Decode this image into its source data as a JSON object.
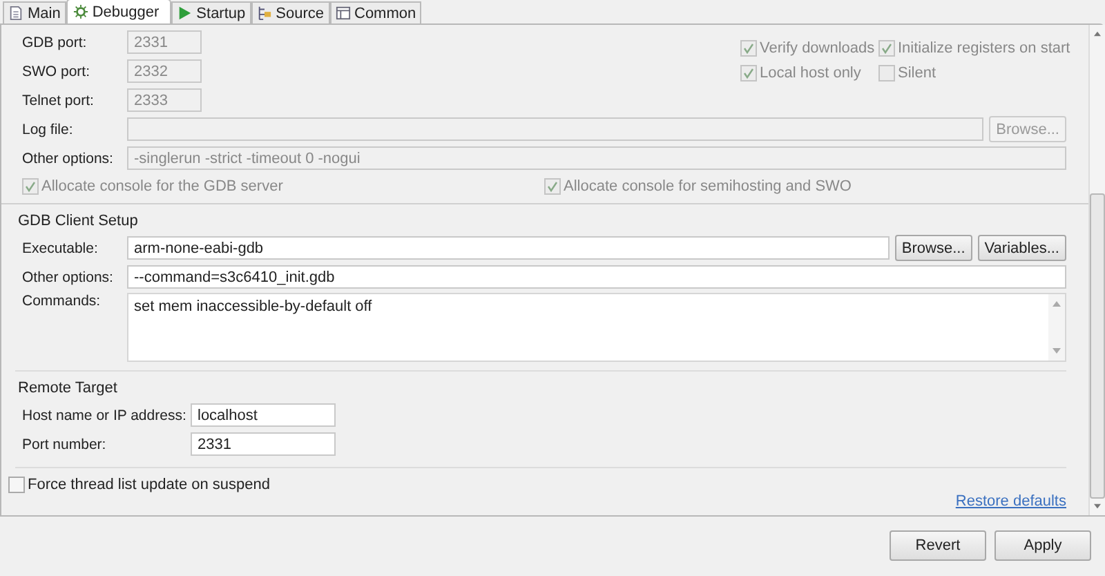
{
  "tabs": [
    {
      "label": "Main",
      "selected": false
    },
    {
      "label": "Debugger",
      "selected": true
    },
    {
      "label": "Startup",
      "selected": false
    },
    {
      "label": "Source",
      "selected": false
    },
    {
      "label": "Common",
      "selected": false
    }
  ],
  "gdb_server": {
    "ports": [
      {
        "label": "GDB port:",
        "value": "2331",
        "disabled": true
      },
      {
        "label": "SWO port:",
        "value": "2332",
        "disabled": true
      },
      {
        "label": "Telnet port:",
        "value": "2333",
        "disabled": true
      }
    ],
    "right_options": [
      [
        {
          "label": "Verify downloads",
          "checked": true,
          "disabled": true
        },
        {
          "label": "Initialize registers on start",
          "checked": true,
          "disabled": true
        }
      ],
      [
        {
          "label": "Local host only",
          "checked": true,
          "disabled": true
        },
        {
          "label": "Silent",
          "checked": false,
          "disabled": true
        }
      ]
    ],
    "log_file": {
      "label": "Log file:",
      "disabled": true,
      "button": "Browse..."
    },
    "other_options": {
      "label": "Other options:",
      "value": "-singlerun -strict -timeout 0 -nogui",
      "disabled": true
    },
    "console_options": [
      {
        "label": "Allocate console for the GDB server",
        "checked": true,
        "disabled": true
      },
      {
        "label": "Allocate console for semihosting and SWO",
        "checked": true,
        "disabled": true
      }
    ]
  },
  "gdb_client": {
    "title": "GDB Client Setup",
    "executable": {
      "label": "Executable:",
      "value": "arm-none-eabi-gdb",
      "buttons": [
        "Browse...",
        "Variables..."
      ]
    },
    "other_options": {
      "label": "Other options:",
      "value": "--command=s3c6410_init.gdb"
    },
    "commands": {
      "label": "Commands:",
      "value": "set mem inaccessible-by-default off"
    }
  },
  "remote_target": {
    "title": "Remote Target",
    "host": {
      "label": "Host name or IP address:",
      "value": "localhost"
    },
    "port": {
      "label": "Port number:",
      "value": "2331"
    }
  },
  "force_thread": {
    "label": "Force thread list update on suspend",
    "checked": false
  },
  "restore_defaults": "Restore defaults",
  "buttons": [
    "Revert",
    "Apply"
  ]
}
